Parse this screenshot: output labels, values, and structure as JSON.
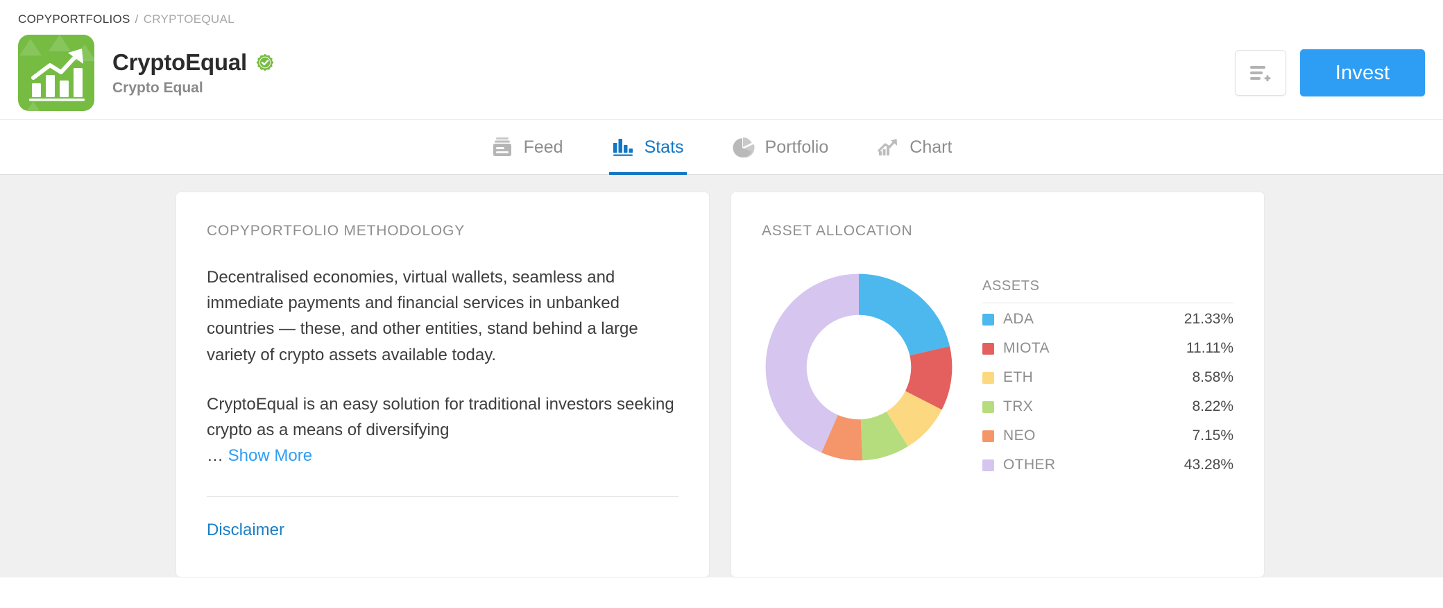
{
  "breadcrumb": {
    "root": "COPYPORTFOLIOS",
    "separator": "/",
    "leaf": "CRYPTOEQUAL"
  },
  "header": {
    "title": "CryptoEqual",
    "subtitle": "Crypto Equal",
    "verified": true,
    "logo_color": "#76bc43",
    "watchlist_label": "",
    "invest_label": "Invest",
    "accent_color": "#2e9ef4"
  },
  "tabs": [
    {
      "label": "Feed",
      "icon": "feed-icon",
      "active": false
    },
    {
      "label": "Stats",
      "icon": "bar-chart-icon",
      "active": true
    },
    {
      "label": "Portfolio",
      "icon": "pie-chart-icon",
      "active": false
    },
    {
      "label": "Chart",
      "icon": "trending-up-icon",
      "active": false
    }
  ],
  "methodology": {
    "title": "COPYPORTFOLIO METHODOLOGY",
    "paragraph1": "Decentralised economies, virtual wallets, seamless and immediate  payments and financial services in unbanked countries — these, and other entities, stand behind a large variety of crypto assets available  today.",
    "paragraph2": "CryptoEqual is an easy solution for traditional investors seeking crypto as a means of diversifying",
    "ellipsis": "…",
    "show_more_label": "Show More",
    "disclaimer_label": "Disclaimer"
  },
  "allocation": {
    "title": "ASSET ALLOCATION",
    "legend_header": "ASSETS"
  },
  "chart_data": {
    "type": "pie",
    "title": "ASSET ALLOCATION",
    "subtitle": "ASSETS",
    "donut": true,
    "inner_radius_ratio": 0.56,
    "start_angle_deg": 0,
    "direction": "clockwise",
    "legend_position": "right",
    "labels": [
      "ADA",
      "MIOTA",
      "ETH",
      "TRX",
      "NEO",
      "OTHER"
    ],
    "values": [
      21.33,
      11.11,
      8.58,
      8.22,
      7.15,
      43.28
    ],
    "value_labels": [
      "21.33%",
      "11.11%",
      "8.58%",
      "8.22%",
      "7.15%",
      "43.28%"
    ],
    "colors": [
      "#4cb8ed",
      "#e4605e",
      "#fcd980",
      "#b6dd7d",
      "#f4956a",
      "#d5c5ef"
    ],
    "unit": "%",
    "total": 99.67
  }
}
